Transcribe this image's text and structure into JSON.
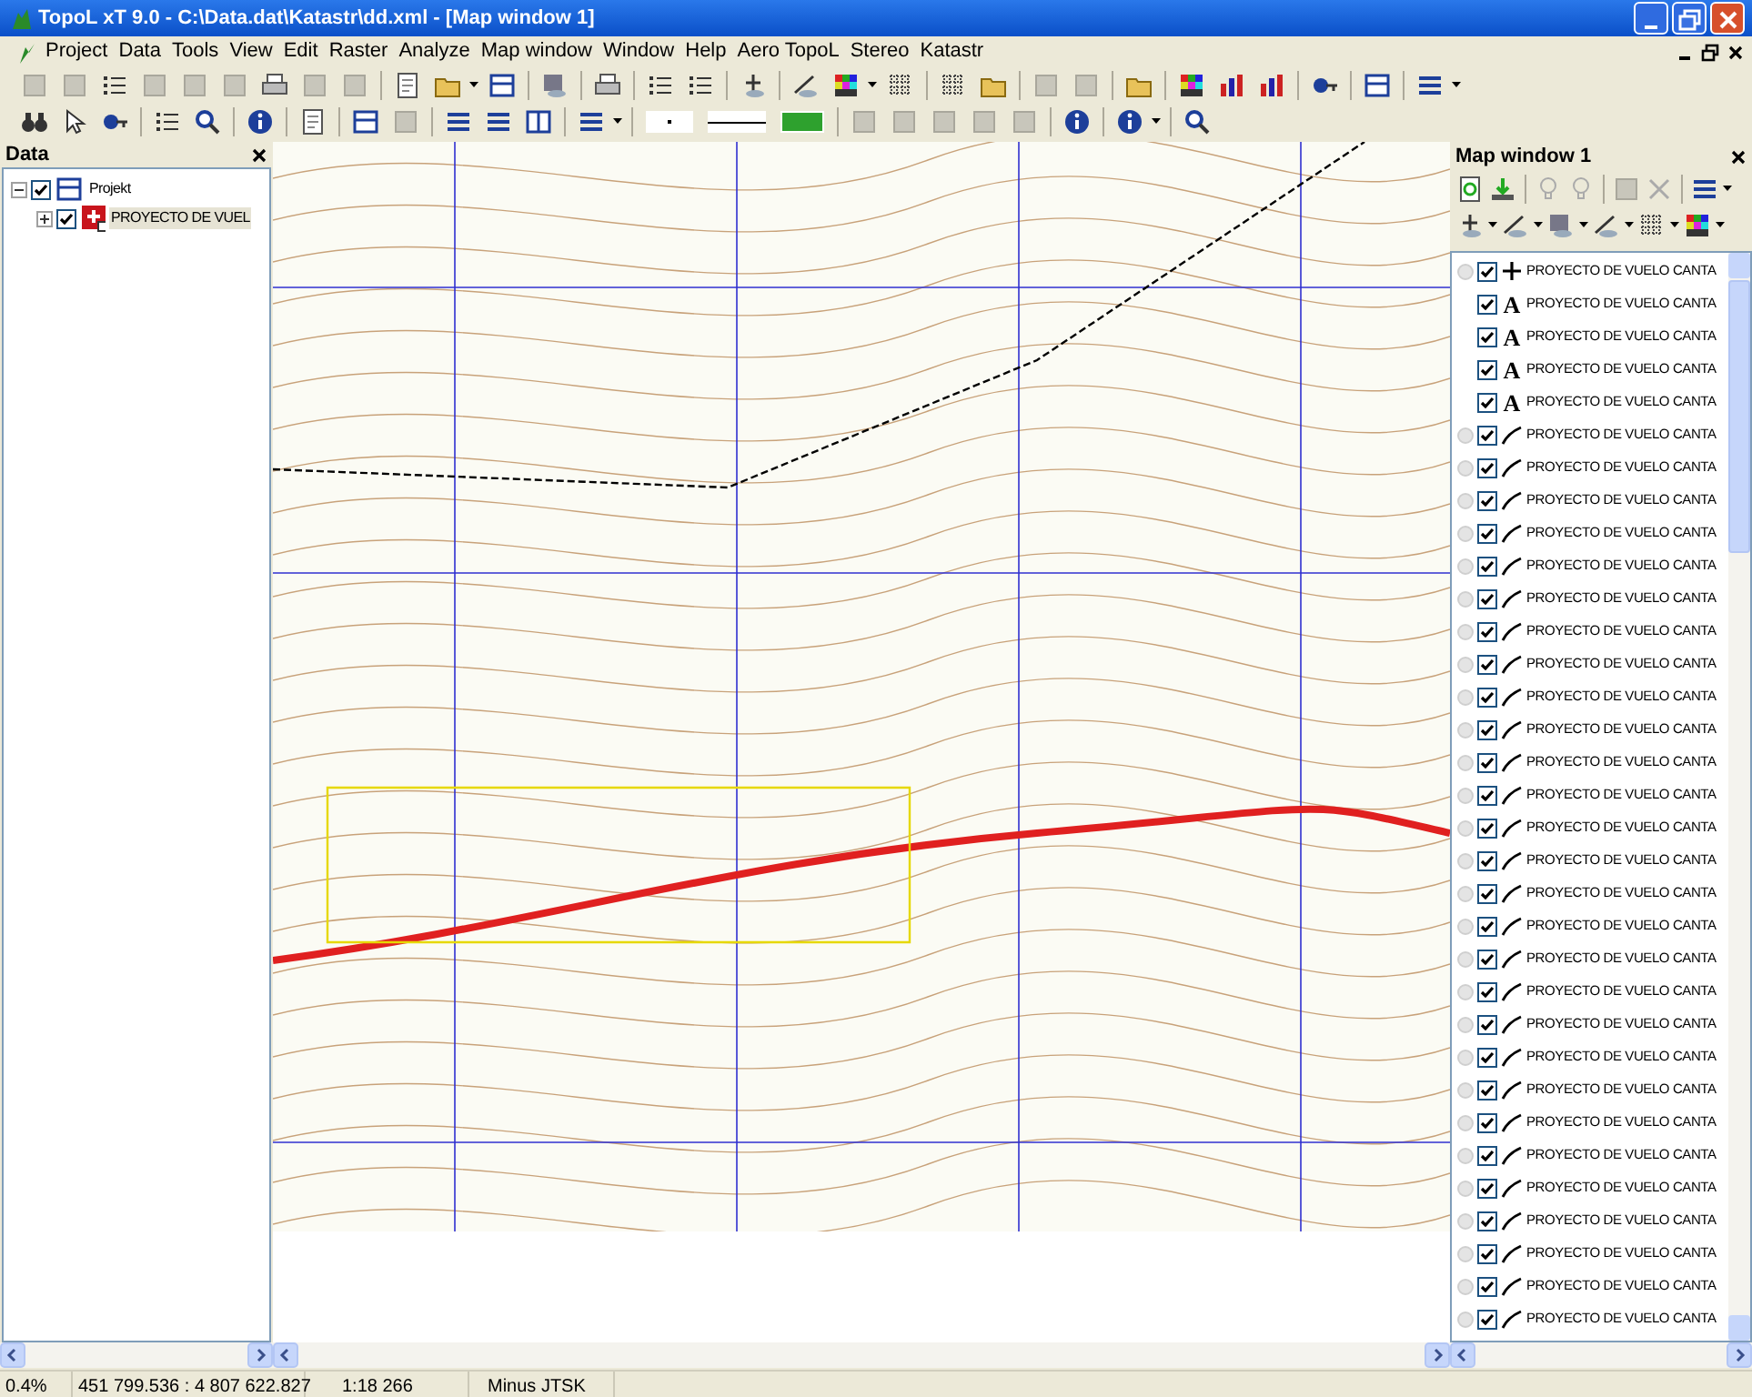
{
  "window": {
    "title": "TopoL xT 9.0 - C:\\Data.dat\\Katastr\\dd.xml - [Map window 1]"
  },
  "menu": [
    "Project",
    "Data",
    "Tools",
    "View",
    "Edit",
    "Raster",
    "Analyze",
    "Map window",
    "Window",
    "Help",
    "Aero TopoL",
    "Stereo",
    "Katastr"
  ],
  "data_panel": {
    "title": "Data",
    "tree": [
      {
        "label": "Projekt",
        "checked": true,
        "expanded": true,
        "selected": false,
        "children": [
          {
            "label": "PROYECTO DE VUEL",
            "checked": true,
            "expanded": false,
            "selected": true
          }
        ]
      }
    ]
  },
  "map_panel": {
    "title": "Map window 1",
    "layers": [
      {
        "kind": "point",
        "label": "PROYECTO DE VUELO CANTA",
        "checked": true
      },
      {
        "kind": "text",
        "symbol": "A",
        "label": "PROYECTO DE VUELO CANTA",
        "checked": true
      },
      {
        "kind": "text",
        "symbol": "A",
        "label": "PROYECTO DE VUELO CANTA",
        "checked": true
      },
      {
        "kind": "text",
        "symbol": "A",
        "label": "PROYECTO DE VUELO CANTA",
        "checked": true
      },
      {
        "kind": "text",
        "symbol": "A",
        "label": "PROYECTO DE VUELO CANTA",
        "checked": true
      },
      {
        "kind": "line",
        "label": "PROYECTO DE VUELO CANTA",
        "checked": true
      },
      {
        "kind": "line",
        "label": "PROYECTO DE VUELO CANTA",
        "checked": true
      },
      {
        "kind": "line",
        "label": "PROYECTO DE VUELO CANTA",
        "checked": true
      },
      {
        "kind": "line",
        "label": "PROYECTO DE VUELO CANTA",
        "checked": true
      },
      {
        "kind": "line",
        "label": "PROYECTO DE VUELO CANTA",
        "checked": true
      },
      {
        "kind": "line",
        "label": "PROYECTO DE VUELO CANTA",
        "checked": true
      },
      {
        "kind": "line",
        "label": "PROYECTO DE VUELO CANTA",
        "checked": true
      },
      {
        "kind": "line",
        "label": "PROYECTO DE VUELO CANTA",
        "checked": true
      },
      {
        "kind": "line",
        "label": "PROYECTO DE VUELO CANTA",
        "checked": true
      },
      {
        "kind": "line",
        "label": "PROYECTO DE VUELO CANTA",
        "checked": true
      },
      {
        "kind": "line",
        "label": "PROYECTO DE VUELO CANTA",
        "checked": true
      },
      {
        "kind": "line",
        "label": "PROYECTO DE VUELO CANTA",
        "checked": true
      },
      {
        "kind": "line",
        "label": "PROYECTO DE VUELO CANTA",
        "checked": true
      },
      {
        "kind": "line",
        "label": "PROYECTO DE VUELO CANTA",
        "checked": true
      },
      {
        "kind": "line",
        "label": "PROYECTO DE VUELO CANTA",
        "checked": true
      },
      {
        "kind": "line",
        "label": "PROYECTO DE VUELO CANTA",
        "checked": true
      },
      {
        "kind": "line",
        "label": "PROYECTO DE VUELO CANTA",
        "checked": true
      },
      {
        "kind": "line",
        "label": "PROYECTO DE VUELO CANTA",
        "checked": true
      },
      {
        "kind": "line",
        "label": "PROYECTO DE VUELO CANTA",
        "checked": true
      },
      {
        "kind": "line",
        "label": "PROYECTO DE VUELO CANTA",
        "checked": true
      },
      {
        "kind": "line",
        "label": "PROYECTO DE VUELO CANTA",
        "checked": true
      },
      {
        "kind": "line",
        "label": "PROYECTO DE VUELO CANTA",
        "checked": true
      },
      {
        "kind": "line",
        "label": "PROYECTO DE VUELO CANTA",
        "checked": true
      },
      {
        "kind": "line",
        "label": "PROYECTO DE VUELO CANTA",
        "checked": true
      },
      {
        "kind": "line",
        "label": "PROYECTO DE VUELO CANTA",
        "checked": true
      },
      {
        "kind": "line",
        "label": "PROYECTO DE VUELO CANTA",
        "checked": true
      },
      {
        "kind": "line",
        "label": "PROYECTO DE VUELO CANTA",
        "checked": true
      },
      {
        "kind": "line",
        "label": "PROYECTO DE VUELO CANTA",
        "checked": true
      }
    ]
  },
  "status_bar": [
    "0.4%",
    "451 799.536 : 4 807 622.827",
    "1:18 266",
    "Minus JTSK"
  ]
}
